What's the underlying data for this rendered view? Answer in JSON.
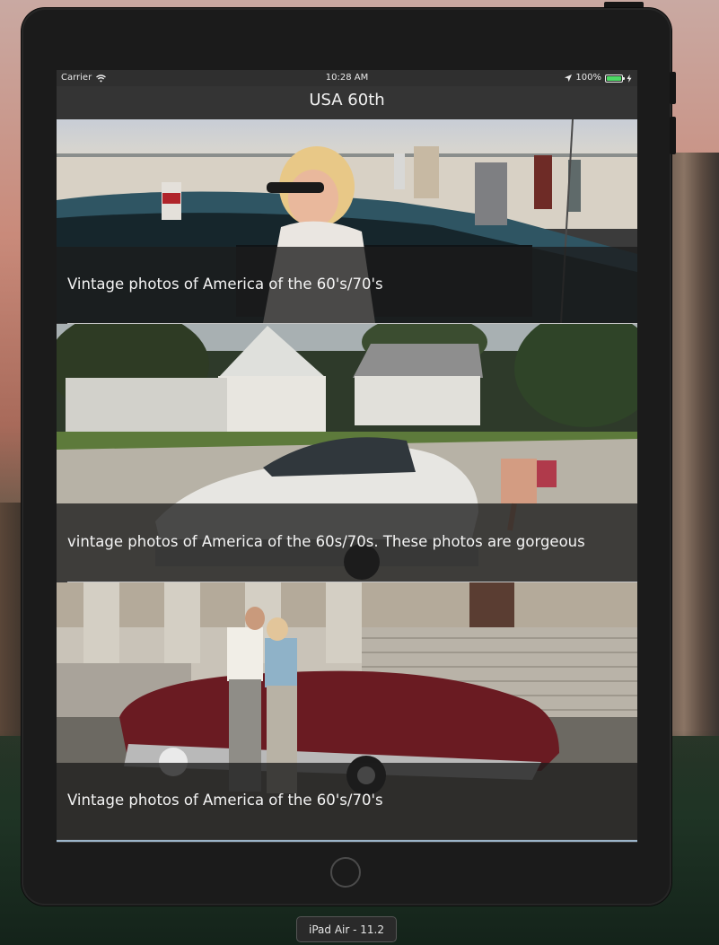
{
  "status_bar": {
    "carrier": "Carrier",
    "time": "10:28 AM",
    "battery_percent": "100%"
  },
  "nav": {
    "title": "USA 60th"
  },
  "feed": {
    "items": [
      {
        "caption": "Vintage photos of America of the 60's/70's"
      },
      {
        "caption": "vintage photos of America of the 60s/70s. These photos are gorgeous"
      },
      {
        "caption": "Vintage photos of America of the 60's/70's"
      }
    ]
  },
  "simulator": {
    "device_label": "iPad Air - 11.2"
  },
  "colors": {
    "battery_fill": "#4cd964",
    "navbar": "#343434",
    "device_frame": "#1b1b1b"
  }
}
